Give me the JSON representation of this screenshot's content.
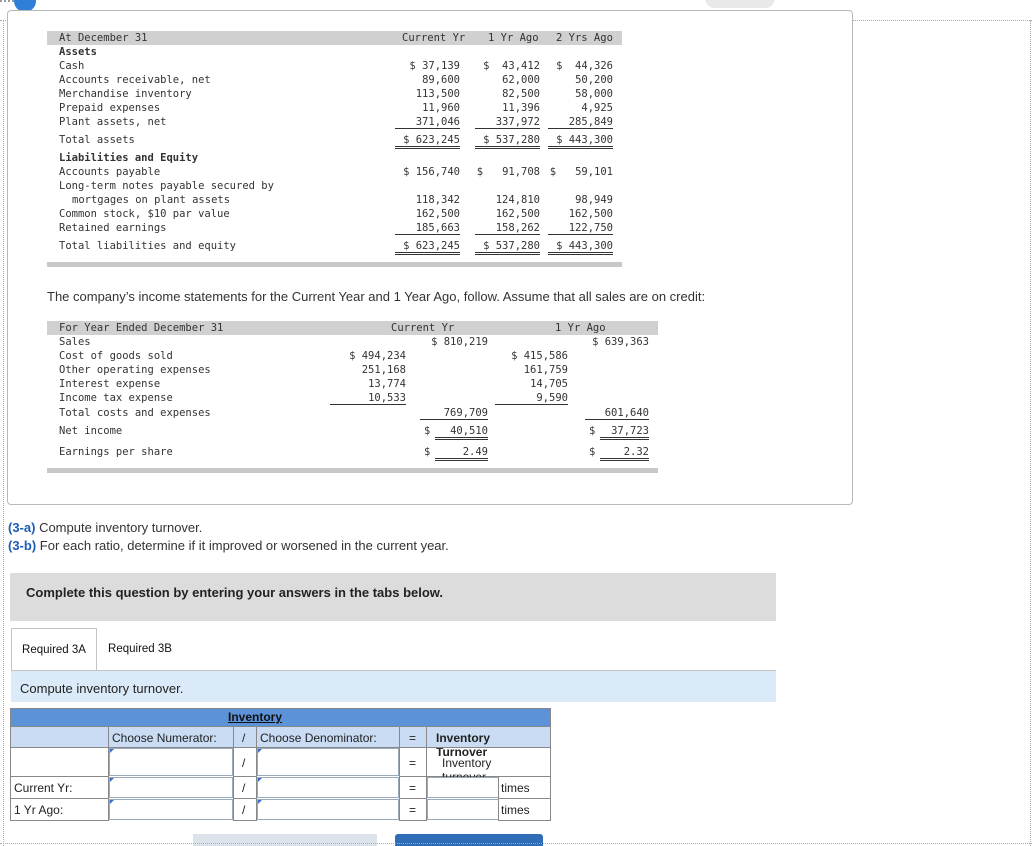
{
  "balance_sheet": {
    "header": {
      "label": "At December 31",
      "c1": "Current Yr",
      "c2": "1 Yr Ago",
      "c3": "2 Yrs Ago"
    },
    "assets_heading": "Assets",
    "asset_rows": [
      {
        "label": "Cash",
        "c1": "$ 37,139",
        "c2": "$  43,412",
        "c3": "$  44,326"
      },
      {
        "label": "Accounts receivable, net",
        "c1": "89,600",
        "c2": "62,000",
        "c3": "50,200"
      },
      {
        "label": "Merchandise inventory",
        "c1": "113,500",
        "c2": "82,500",
        "c3": "58,000"
      },
      {
        "label": "Prepaid expenses",
        "c1": "11,960",
        "c2": "11,396",
        "c3": "4,925"
      },
      {
        "label": "Plant assets, net",
        "c1": "371,046",
        "c2": "337,972",
        "c3": "285,849"
      }
    ],
    "total_assets": {
      "label": "Total assets",
      "c1": "$ 623,245",
      "c2": "$ 537,280",
      "c3": "$ 443,300"
    },
    "liab_heading": "Liabilities and Equity",
    "accounts_payable": {
      "label": "Accounts payable",
      "c1": "$ 156,740",
      "c2": "$   91,708",
      "c3": "$   59,101"
    },
    "lt_notes_line1": "Long-term notes payable secured by",
    "lt_notes": {
      "label": "mortgages on plant assets",
      "c1": "118,342",
      "c2": "124,810",
      "c3": "98,949"
    },
    "common_stock": {
      "label": "Common stock, $10 par value",
      "c1": "162,500",
      "c2": "162,500",
      "c3": "162,500"
    },
    "retained": {
      "label": "Retained earnings",
      "c1": "185,663",
      "c2": "158,262",
      "c3": "122,750"
    },
    "total_le": {
      "label": "Total liabilities and equity",
      "c1": "$ 623,245",
      "c2": "$ 537,280",
      "c3": "$ 443,300"
    }
  },
  "intro_text": "The company’s income statements for the Current Year and 1 Year Ago, follow. Assume that all sales are on credit:",
  "income_statement": {
    "header": {
      "label": "For Year Ended December 31",
      "c1": "Current Yr",
      "c2": "1 Yr Ago"
    },
    "sales": {
      "label": "Sales",
      "cy": "$ 810,219",
      "py": "$ 639,363"
    },
    "expenses": [
      {
        "label": "Cost of goods sold",
        "cy": "$ 494,234",
        "py": "$ 415,586"
      },
      {
        "label": "Other operating expenses",
        "cy": "251,168",
        "py": "161,759"
      },
      {
        "label": "Interest expense",
        "cy": "13,774",
        "py": "14,705"
      },
      {
        "label": "Income tax expense",
        "cy": "10,533",
        "py": "9,590"
      }
    ],
    "total_costs": {
      "label": "Total costs and expenses",
      "cy": "769,709",
      "py": "601,640"
    },
    "net_income": {
      "label": "Net income",
      "cy_sym": "$",
      "cy": "40,510",
      "py_sym": "$",
      "py": "37,723"
    },
    "eps": {
      "label": "Earnings per share",
      "cy_sym": "$",
      "cy": "2.49",
      "py_sym": "$",
      "py": "2.32"
    }
  },
  "questions": {
    "q3a_label": "(3-a)",
    "q3a_text": " Compute inventory turnover.",
    "q3b_label": "(3-b)",
    "q3b_text": " For each ratio, determine if it improved or worsened in the current year."
  },
  "complete_text": "Complete this question by entering your answers in the tabs below.",
  "tabs": [
    "Required 3A",
    "Required 3B"
  ],
  "instruction": "Compute inventory turnover.",
  "answer_table": {
    "title": "Inventory Turnover",
    "numerator_label": "Choose Numerator:",
    "slash": "/",
    "denominator_label": "Choose Denominator:",
    "equals": "=",
    "result_header": "Inventory Turnover",
    "result_sub": "Inventory turnover",
    "rows": [
      {
        "label": "Current Yr:",
        "unit": "times"
      },
      {
        "label": "1 Yr Ago:",
        "unit": "times"
      }
    ]
  }
}
